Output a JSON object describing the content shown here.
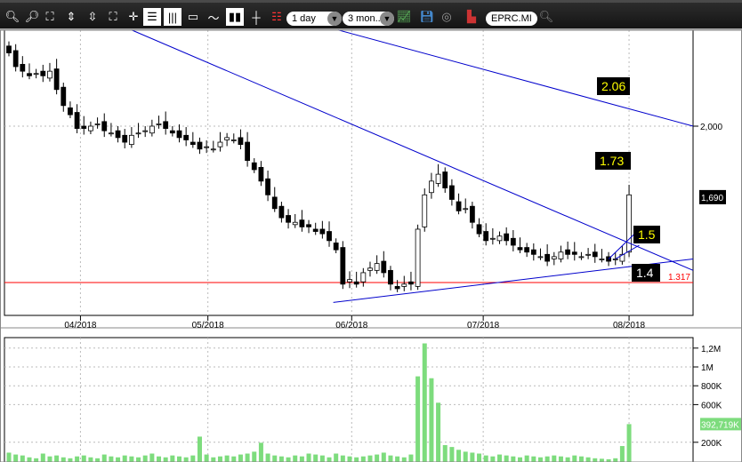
{
  "toolbar": {
    "interval": "1 day",
    "range": "3 mon..",
    "symbol": "EPRC.MI",
    "icons": [
      "zoom-in-icon",
      "zoom-out-icon",
      "zoom-fit-icon",
      "zoom-in-vertical-icon",
      "zoom-out-vertical-icon",
      "zoom-reset-icon",
      "crosshair-icon",
      "bar-chart-icon",
      "volume-bars-icon",
      "window-icon",
      "line-chart-icon",
      "candlestick-icon",
      "ohlc-icon",
      "indicators-icon",
      "drawing-icon",
      "save-icon",
      "refresh-icon",
      "export-icon",
      "search-icon"
    ]
  },
  "price_axis": {
    "labels": [
      {
        "text": "2,000",
        "value": 2.0
      }
    ],
    "last_price": "1,690",
    "last_value": 1.69,
    "support_label": "1.317",
    "support_value": 1.317
  },
  "x_axis": {
    "labels": [
      {
        "text": "04/2018",
        "index": 10.5
      },
      {
        "text": "05/2018",
        "index": 29.2
      },
      {
        "text": "06/2018",
        "index": 50.3
      },
      {
        "text": "07/2018",
        "index": 69.6
      },
      {
        "text": "08/2018",
        "index": 91
      }
    ]
  },
  "annotations": [
    {
      "text": "2.06",
      "color": "#ffff00"
    },
    {
      "text": "1.73",
      "color": "#ffff00"
    },
    {
      "text": "1.5",
      "color": "#ffff00"
    },
    {
      "text": "1.4",
      "color": "#ffffff"
    }
  ],
  "volume_axis": {
    "labels": [
      {
        "text": "1,2M",
        "value": 1200
      },
      {
        "text": "1M",
        "value": 1000
      },
      {
        "text": "800K",
        "value": 800
      },
      {
        "text": "600K",
        "value": 600
      },
      {
        "text": "200K",
        "value": 200
      }
    ],
    "last_volume": "392,719K",
    "last_value": 392.7
  },
  "chart_data": {
    "type": "candlestick",
    "title": "EPRC.MI",
    "interval": "1 day",
    "closes": [
      2.32,
      2.26,
      2.24,
      2.22,
      2.23,
      2.22,
      2.24,
      2.16,
      2.09,
      2.05,
      1.99,
      1.99,
      2.0,
      2.01,
      1.98,
      1.97,
      1.95,
      1.93,
      1.96,
      1.97,
      1.98,
      2.0,
      2.01,
      1.99,
      1.97,
      1.95,
      1.94,
      1.92,
      1.9,
      1.91,
      1.9,
      1.93,
      1.95,
      1.94,
      1.92,
      1.85,
      1.81,
      1.76,
      1.7,
      1.64,
      1.6,
      1.58,
      1.58,
      1.56,
      1.56,
      1.54,
      1.53,
      1.5,
      1.46,
      1.31,
      1.33,
      1.31,
      1.36,
      1.38,
      1.4,
      1.36,
      1.31,
      1.29,
      1.31,
      1.31,
      1.55,
      1.7,
      1.76,
      1.79,
      1.73,
      1.68,
      1.63,
      1.64,
      1.58,
      1.53,
      1.5,
      1.51,
      1.52,
      1.5,
      1.48,
      1.46,
      1.45,
      1.44,
      1.43,
      1.41,
      1.43,
      1.45,
      1.44,
      1.44,
      1.43,
      1.44,
      1.43,
      1.42,
      1.41,
      1.42,
      1.44,
      1.7
    ],
    "volumes_k": [
      90,
      70,
      60,
      40,
      30,
      80,
      50,
      60,
      40,
      30,
      50,
      60,
      40,
      30,
      70,
      50,
      40,
      60,
      50,
      40,
      60,
      80,
      50,
      40,
      60,
      50,
      40,
      60,
      260,
      70,
      40,
      50,
      60,
      50,
      70,
      80,
      100,
      195,
      80,
      60,
      50,
      40,
      60,
      50,
      80,
      70,
      60,
      40,
      80,
      60,
      50,
      40,
      50,
      60,
      70,
      90,
      60,
      50,
      40,
      70,
      900,
      1250,
      880,
      620,
      170,
      150,
      120,
      100,
      90,
      80,
      60,
      50,
      70,
      60,
      50,
      40,
      60,
      50,
      40,
      50,
      60,
      50,
      40,
      60,
      50,
      40,
      30,
      25,
      20,
      30,
      160,
      392.7
    ],
    "ylim": [
      1.2,
      2.45
    ],
    "volume_ylim": [
      0,
      1300
    ],
    "trendlines": [
      {
        "from": [
          18,
          2.42
        ],
        "to": [
          100.4,
          1.37
        ]
      },
      {
        "from": [
          48.3,
          2.42
        ],
        "to": [
          100.4,
          2.0
        ]
      },
      {
        "from": [
          47.6,
          1.23
        ],
        "to": [
          100.4,
          1.42
        ]
      }
    ],
    "hline": {
      "value": 1.317,
      "color": "#ff0000"
    }
  }
}
